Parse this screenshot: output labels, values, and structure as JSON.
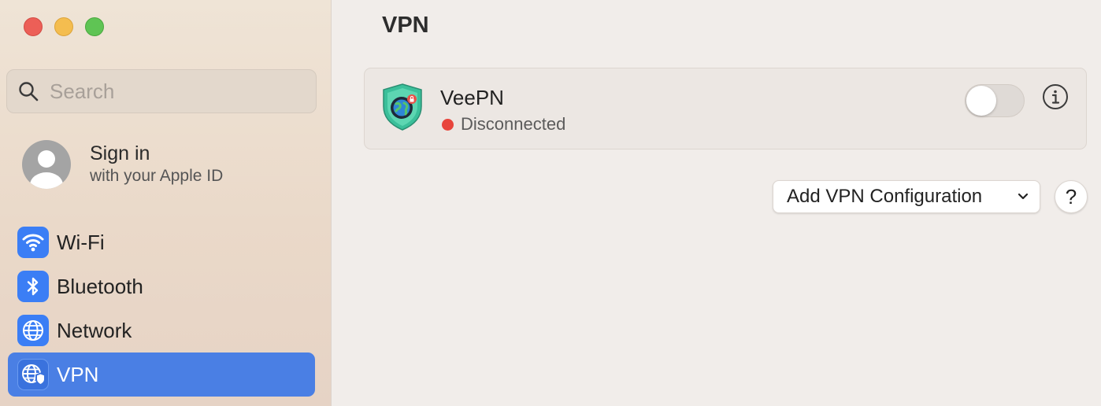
{
  "window": {
    "title": "VPN"
  },
  "sidebar": {
    "search": {
      "placeholder": "Search"
    },
    "account": {
      "title": "Sign in",
      "subtitle": "with your Apple ID"
    },
    "items": [
      {
        "label": "Wi-Fi",
        "icon": "wifi-icon"
      },
      {
        "label": "Bluetooth",
        "icon": "bluetooth-icon"
      },
      {
        "label": "Network",
        "icon": "globe-icon"
      },
      {
        "label": "VPN",
        "icon": "vpn-globe-shield-icon",
        "selected": true
      }
    ]
  },
  "main": {
    "title": "VPN",
    "vpn_service": {
      "name": "VeePN",
      "status": "Disconnected",
      "status_color": "#e8453c",
      "enabled": false
    },
    "add_button_label": "Add VPN Configuration",
    "help_label": "?"
  },
  "colors": {
    "accent": "#4a7fe4"
  }
}
